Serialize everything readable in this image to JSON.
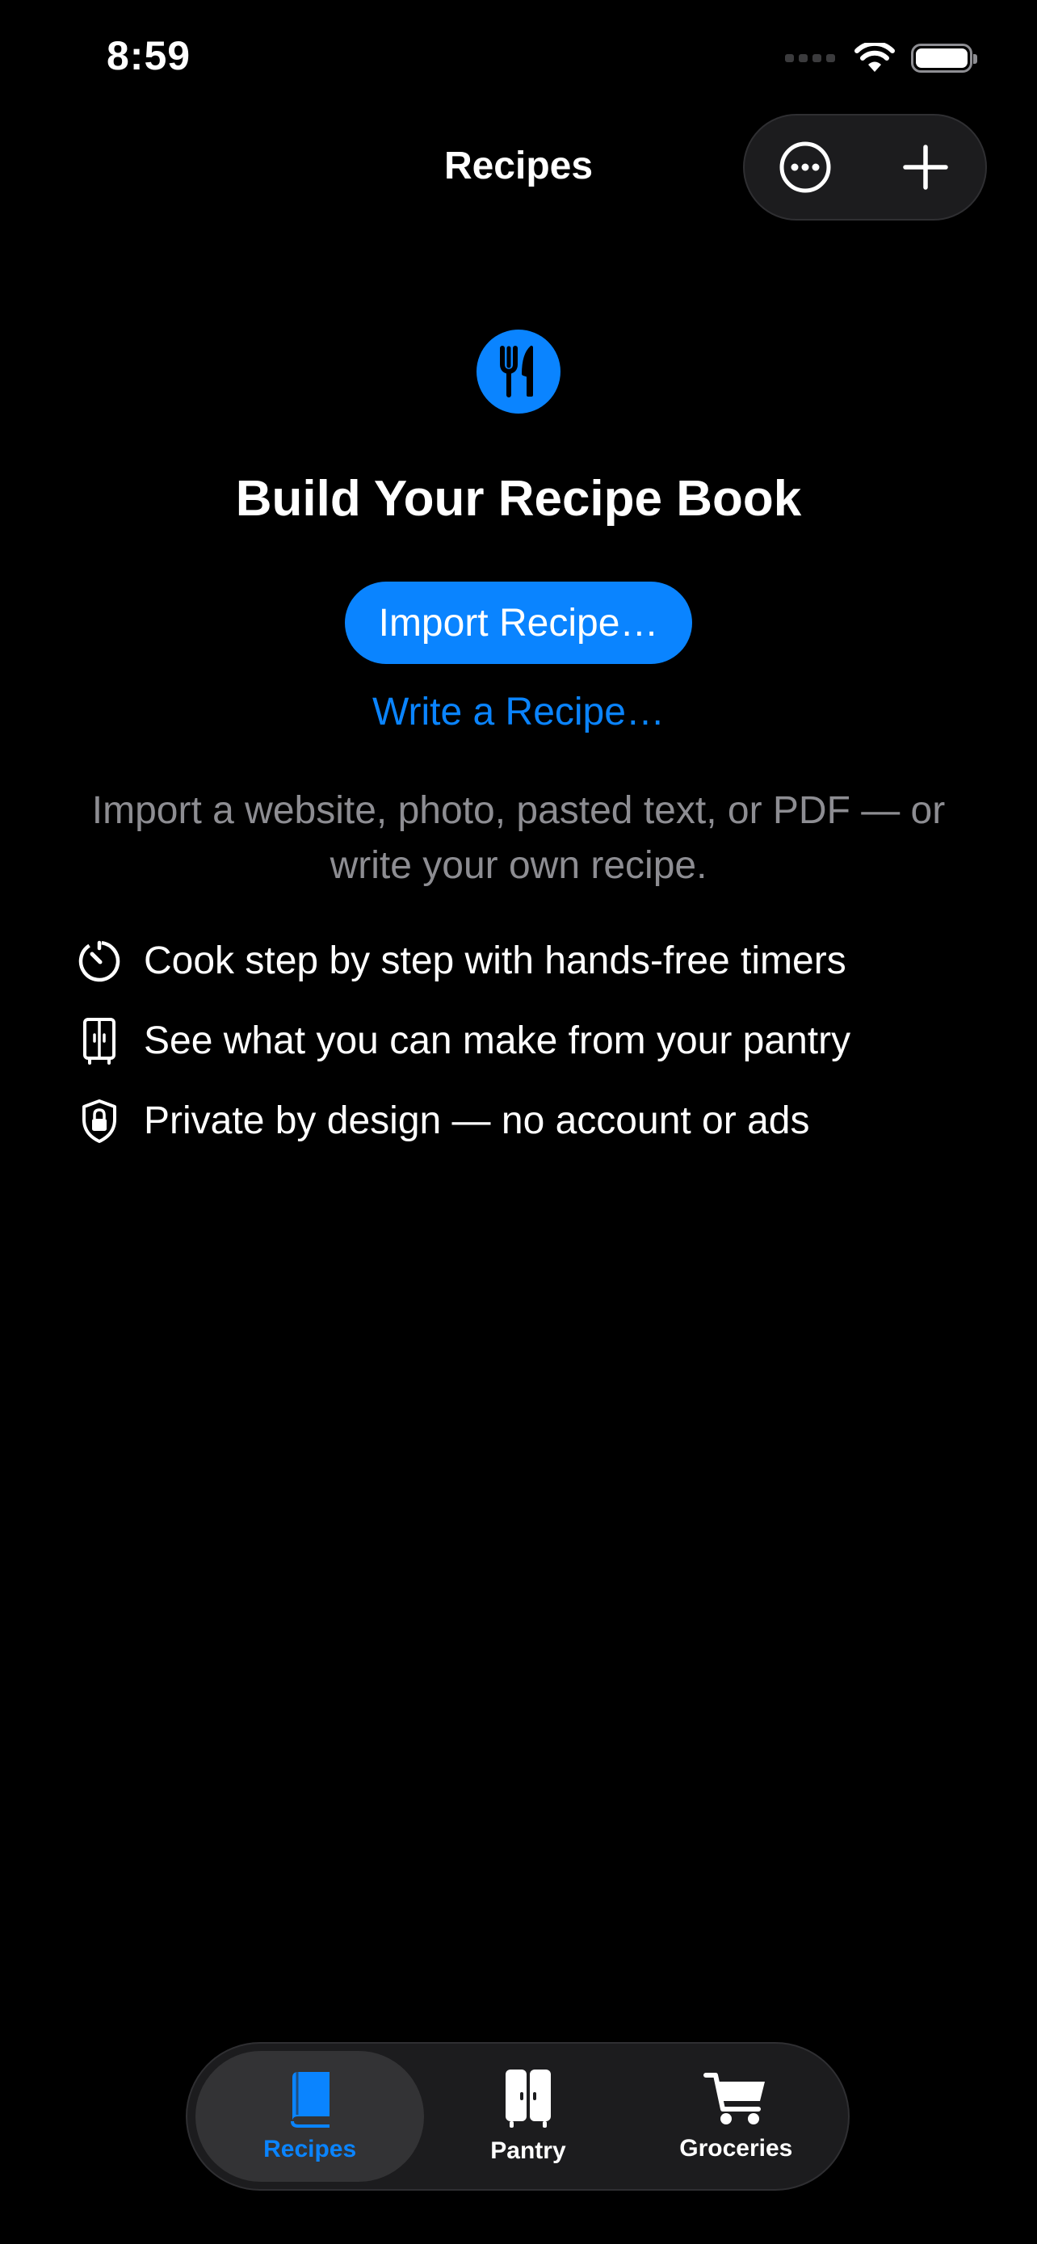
{
  "status_bar": {
    "time": "8:59"
  },
  "nav": {
    "title": "Recipes",
    "more_icon": "ellipsis-circle-icon",
    "add_icon": "plus-icon"
  },
  "empty_state": {
    "icon": "fork-knife-icon",
    "title": "Build Your Recipe Book",
    "import_button": "Import Recipe…",
    "write_link": "Write a Recipe…",
    "description": "Import a website, photo, pasted text, or PDF — or write your own recipe.",
    "features": [
      {
        "icon": "timer-icon",
        "text": "Cook step by step with hands-free timers"
      },
      {
        "icon": "refrigerator-icon",
        "text": "See what you can make from your pantry"
      },
      {
        "icon": "lock-shield-icon",
        "text": "Private by design — no account or ads"
      }
    ]
  },
  "tab_bar": {
    "tabs": [
      {
        "label": "Recipes",
        "icon": "book-icon",
        "selected": true
      },
      {
        "label": "Pantry",
        "icon": "refrigerator-icon",
        "selected": false
      },
      {
        "label": "Groceries",
        "icon": "cart-icon",
        "selected": false
      }
    ]
  },
  "colors": {
    "accent": "#0a84ff",
    "background": "#000000",
    "secondary_text": "#8d8d92"
  }
}
